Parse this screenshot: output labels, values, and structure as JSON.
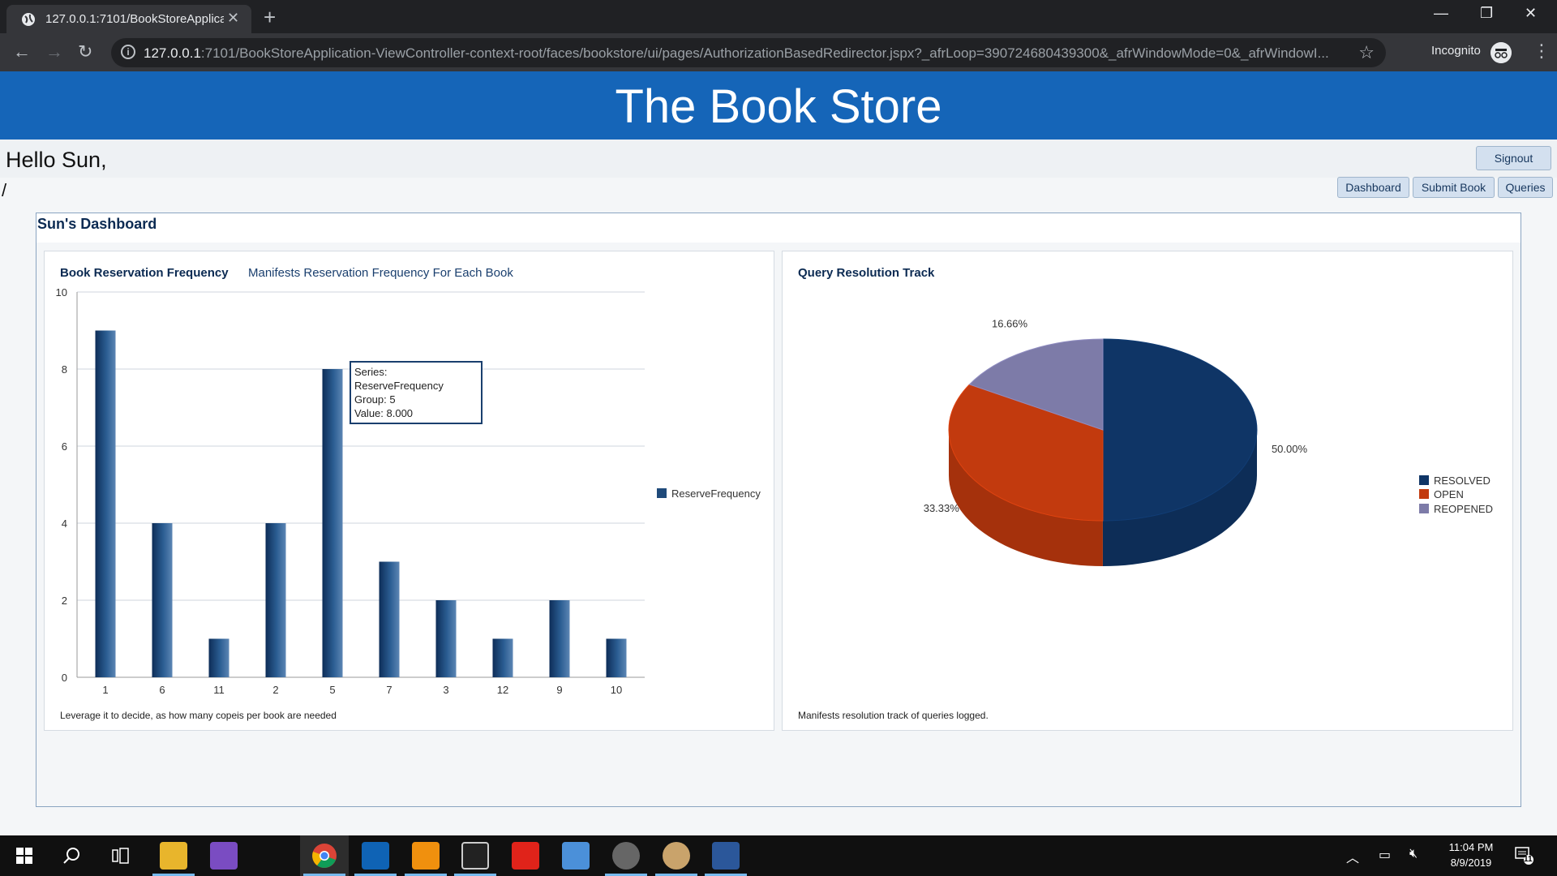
{
  "browser": {
    "tab_title": "127.0.0.1:7101/BookStoreApplica",
    "url_host": "127.0.0.1",
    "url_rest": ":7101/BookStoreApplication-ViewController-context-root/faces/bookstore/ui/pages/AuthorizationBasedRedirector.jspx?_afrLoop=390724680439300&_afrWindowMode=0&_afrWindowI...",
    "incognito_label": "Incognito"
  },
  "page": {
    "banner_title": "The Book Store",
    "greeting": "Hello Sun,",
    "signout_label": "Signout",
    "slash": "/",
    "nav": [
      "Dashboard",
      "Submit Book",
      "Queries"
    ],
    "dashboard_title": "Sun's Dashboard"
  },
  "bar_panel": {
    "title": "Book Reservation Frequency",
    "subtitle": "Manifests Reservation Frequency For Each Book",
    "footer": "Leverage it to decide, as how many copeis per book are needed",
    "tooltip": [
      "Series: ReserveFrequency",
      "Group: 5",
      "Value: 8.000"
    ]
  },
  "pie_panel": {
    "title": "Query Resolution Track",
    "footer": "Manifests resolution track of queries logged."
  },
  "chart_data": [
    {
      "type": "bar",
      "title": "Book Reservation Frequency",
      "categories": [
        "1",
        "6",
        "11",
        "2",
        "5",
        "7",
        "3",
        "12",
        "9",
        "10"
      ],
      "series": [
        {
          "name": "ReserveFrequency",
          "values": [
            9,
            4,
            1,
            4,
            8,
            3,
            2,
            1,
            2,
            1
          ],
          "color": "#1f4a7a"
        }
      ],
      "ylim": [
        0,
        10
      ],
      "yticks": [
        "0",
        "2",
        "4",
        "6",
        "8",
        "10"
      ],
      "grid": true,
      "legend": "right"
    },
    {
      "type": "pie",
      "title": "Query Resolution Track",
      "slices": [
        {
          "label": "RESOLVED",
          "value": 50.0,
          "text": "50.00%",
          "color": "#0f3566"
        },
        {
          "label": "OPEN",
          "value": 33.33,
          "text": "33.33%",
          "color": "#c23a0e"
        },
        {
          "label": "REOPENED",
          "value": 16.66,
          "text": "16.66%",
          "color": "#7d7ba8"
        }
      ],
      "legend": "right"
    }
  ],
  "taskbar": {
    "time": "11:04 PM",
    "date": "8/9/2019",
    "notifications": "11"
  }
}
